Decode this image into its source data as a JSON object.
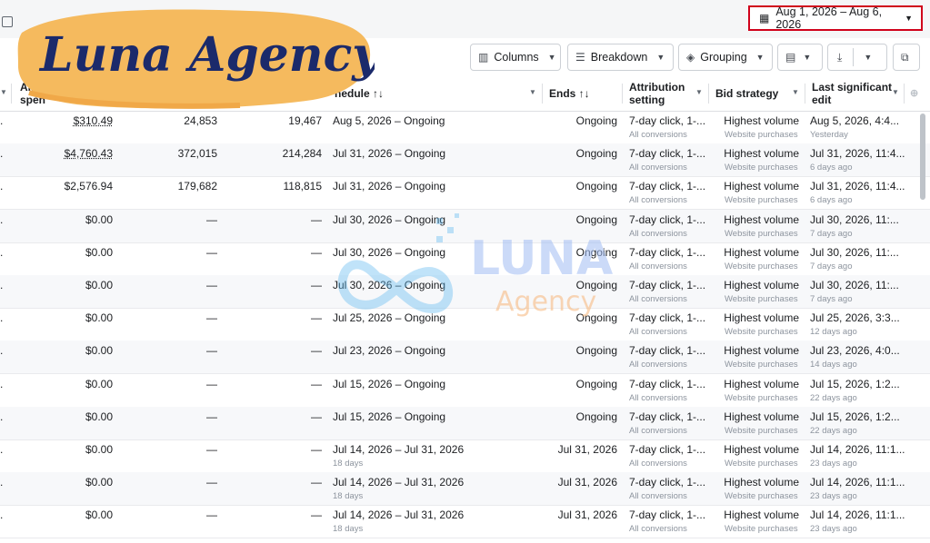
{
  "brand": {
    "name": "Luna Agency"
  },
  "watermark": {
    "word": "LUNA",
    "sub": "Agency"
  },
  "date_range": {
    "label": "Aug 1, 2026 – Aug 6, 2026"
  },
  "toolbar": {
    "columns": "Columns",
    "breakdown": "Breakdown",
    "grouping": "Grouping"
  },
  "headers": {
    "amount_spent_top": "Am",
    "amount_spent_bottom": "spen",
    "schedule": "hedule ↑↓",
    "ends": "Ends ↑↓",
    "attribution_1": "Attribution",
    "attribution_2": "setting",
    "bid_strategy": "Bid strategy",
    "last_edit_1": "Last significant",
    "last_edit_2": "edit"
  },
  "rows": [
    {
      "spent": "$310.49",
      "c1": "24,853",
      "c2": "19,467",
      "schedule": "Aug 5, 2026 – Ongoing",
      "sched_sub": "",
      "ends": "Ongoing",
      "attr": "7-day click, 1-...",
      "attr_sub": "All conversions",
      "bid": "Highest volume",
      "bid_sub": "Website purchases",
      "edit": "Aug 5, 2026, 4:4...",
      "edit_sub": "Yesterday"
    },
    {
      "spent": "$4,760.43",
      "c1": "372,015",
      "c2": "214,284",
      "schedule": "Jul 31, 2026 – Ongoing",
      "sched_sub": "",
      "ends": "Ongoing",
      "attr": "7-day click, 1-...",
      "attr_sub": "All conversions",
      "bid": "Highest volume",
      "bid_sub": "Website purchases",
      "edit": "Jul 31, 2026, 11:4...",
      "edit_sub": "6 days ago"
    },
    {
      "spent": "$2,576.94",
      "c1": "179,682",
      "c2": "118,815",
      "schedule": "Jul 31, 2026 – Ongoing",
      "sched_sub": "",
      "ends": "Ongoing",
      "attr": "7-day click, 1-...",
      "attr_sub": "All conversions",
      "bid": "Highest volume",
      "bid_sub": "Website purchases",
      "edit": "Jul 31, 2026, 11:4...",
      "edit_sub": "6 days ago"
    },
    {
      "spent": "$0.00",
      "c1": "—",
      "c2": "—",
      "schedule": "Jul 30, 2026 – Ongoing",
      "sched_sub": "",
      "ends": "Ongoing",
      "attr": "7-day click, 1-...",
      "attr_sub": "All conversions",
      "bid": "Highest volume",
      "bid_sub": "Website purchases",
      "edit": "Jul 30, 2026, 11:...",
      "edit_sub": "7 days ago"
    },
    {
      "spent": "$0.00",
      "c1": "—",
      "c2": "—",
      "schedule": "Jul 30, 2026 – Ongoing",
      "sched_sub": "",
      "ends": "Ongoing",
      "attr": "7-day click, 1-...",
      "attr_sub": "All conversions",
      "bid": "Highest volume",
      "bid_sub": "Website purchases",
      "edit": "Jul 30, 2026, 11:...",
      "edit_sub": "7 days ago"
    },
    {
      "spent": "$0.00",
      "c1": "—",
      "c2": "—",
      "schedule": "Jul 30, 2026 – Ongoing",
      "sched_sub": "",
      "ends": "Ongoing",
      "attr": "7-day click, 1-...",
      "attr_sub": "All conversions",
      "bid": "Highest volume",
      "bid_sub": "Website purchases",
      "edit": "Jul 30, 2026, 11:...",
      "edit_sub": "7 days ago"
    },
    {
      "spent": "$0.00",
      "c1": "—",
      "c2": "—",
      "schedule": "Jul 25, 2026 – Ongoing",
      "sched_sub": "",
      "ends": "Ongoing",
      "attr": "7-day click, 1-...",
      "attr_sub": "All conversions",
      "bid": "Highest volume",
      "bid_sub": "Website purchases",
      "edit": "Jul 25, 2026, 3:3...",
      "edit_sub": "12 days ago"
    },
    {
      "spent": "$0.00",
      "c1": "—",
      "c2": "—",
      "schedule": "Jul 23, 2026 – Ongoing",
      "sched_sub": "",
      "ends": "Ongoing",
      "attr": "7-day click, 1-...",
      "attr_sub": "All conversions",
      "bid": "Highest volume",
      "bid_sub": "Website purchases",
      "edit": "Jul 23, 2026, 4:0...",
      "edit_sub": "14 days ago"
    },
    {
      "spent": "$0.00",
      "c1": "—",
      "c2": "—",
      "schedule": "Jul 15, 2026 – Ongoing",
      "sched_sub": "",
      "ends": "Ongoing",
      "attr": "7-day click, 1-...",
      "attr_sub": "All conversions",
      "bid": "Highest volume",
      "bid_sub": "Website purchases",
      "edit": "Jul 15, 2026, 1:2...",
      "edit_sub": "22 days ago"
    },
    {
      "spent": "$0.00",
      "c1": "—",
      "c2": "—",
      "schedule": "Jul 15, 2026 – Ongoing",
      "sched_sub": "",
      "ends": "Ongoing",
      "attr": "7-day click, 1-...",
      "attr_sub": "All conversions",
      "bid": "Highest volume",
      "bid_sub": "Website purchases",
      "edit": "Jul 15, 2026, 1:2...",
      "edit_sub": "22 days ago"
    },
    {
      "spent": "$0.00",
      "c1": "—",
      "c2": "—",
      "schedule": "Jul 14, 2026 – Jul 31, 2026",
      "sched_sub": "18 days",
      "ends": "Jul 31, 2026",
      "attr": "7-day click, 1-...",
      "attr_sub": "All conversions",
      "bid": "Highest volume",
      "bid_sub": "Website purchases",
      "edit": "Jul 14, 2026, 11:1...",
      "edit_sub": "23 days ago"
    },
    {
      "spent": "$0.00",
      "c1": "—",
      "c2": "—",
      "schedule": "Jul 14, 2026 – Jul 31, 2026",
      "sched_sub": "18 days",
      "ends": "Jul 31, 2026",
      "attr": "7-day click, 1-...",
      "attr_sub": "All conversions",
      "bid": "Highest volume",
      "bid_sub": "Website purchases",
      "edit": "Jul 14, 2026, 11:1...",
      "edit_sub": "23 days ago"
    },
    {
      "spent": "$0.00",
      "c1": "—",
      "c2": "—",
      "schedule": "Jul 14, 2026 – Jul 31, 2026",
      "sched_sub": "18 days",
      "ends": "Jul 31, 2026",
      "attr": "7-day click, 1-...",
      "attr_sub": "All conversions",
      "bid": "Highest volume",
      "bid_sub": "Website purchases",
      "edit": "Jul 14, 2026, 11:1...",
      "edit_sub": "23 days ago"
    }
  ]
}
